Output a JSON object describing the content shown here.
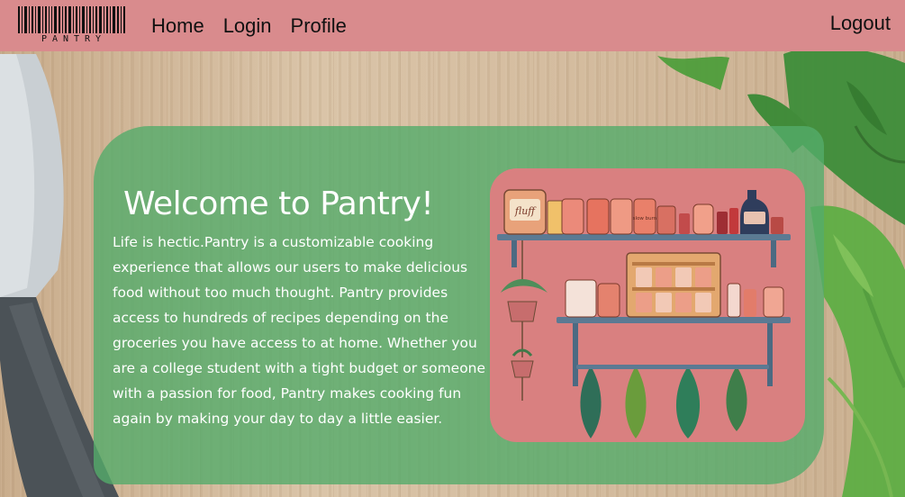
{
  "navbar": {
    "logo_text": "PANTRY",
    "links": [
      {
        "label": "Home"
      },
      {
        "label": "Login"
      },
      {
        "label": "Profile"
      }
    ],
    "logout_label": "Logout"
  },
  "hero": {
    "title": "Welcome to Pantry!",
    "description": "Life is hectic.Pantry is a customizable cooking experience that allows our users to make delicious food without too much thought. Pantry provides access to hundreds of recipes depending on the groceries you have access to at home. Whether you are a college student with a tight budget or someone with a passion for food, Pantry makes cooking fun again by making your day to day a little easier.",
    "illustration": {
      "jar_labels": [
        "fluff",
        "slow burn"
      ]
    }
  },
  "colors": {
    "navbar": "#d98b8d",
    "hero_card": "#54ab6a",
    "illustration_bg": "#d98080",
    "text_light": "#ffffff"
  }
}
